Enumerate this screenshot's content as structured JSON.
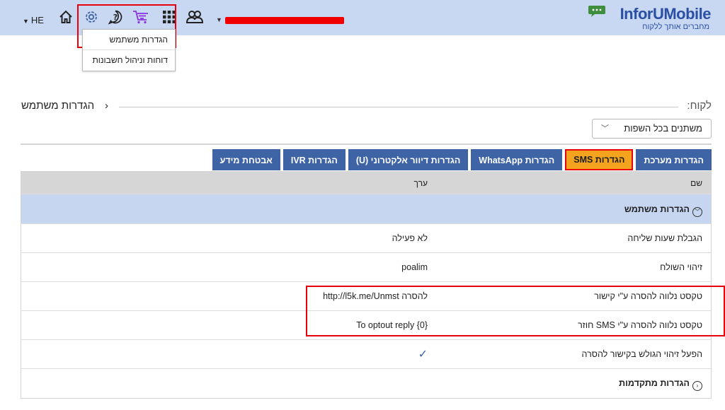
{
  "topbar": {
    "language": "HE",
    "icons": [
      "home-icon",
      "gear-icon",
      "help-icon",
      "cart-icon",
      "apps-grid-icon",
      "users-icon"
    ],
    "colors": {
      "bar_bg": "#c9d8f2",
      "icon_blue": "#3e64a6",
      "cart_purple": "#8b2fe0",
      "highlight_red": "#e8000b"
    }
  },
  "logo": {
    "brand_part1": "InforU",
    "brand_part2": "Mobile",
    "tagline": "מחברים אותך ללקוח"
  },
  "settings_menu": {
    "items": [
      "הגדרות משתמש",
      "דוחות וניהול חשבונות"
    ]
  },
  "heading": {
    "breadcrumb": "הגדרות משתמש",
    "client_label": "לקוח:"
  },
  "filter_select": {
    "value": "משתנים בכל השפות"
  },
  "tabs": [
    {
      "label": "הגדרות מערכת",
      "active": false
    },
    {
      "label": "הגדרות SMS",
      "active": true
    },
    {
      "label": "הגדרות WhatsApp",
      "active": false
    },
    {
      "label": "הגדרות דיוור אלקטרוני (U)",
      "active": false
    },
    {
      "label": "הגדרות IVR",
      "active": false
    },
    {
      "label": "אבטחת מידע",
      "active": false
    }
  ],
  "table": {
    "headers": {
      "name": "שם",
      "value": "ערך"
    },
    "group_title": "הגדרות משתמש",
    "rows": [
      {
        "name": "הגבלת שעות שליחה",
        "value": "לא פעילה"
      },
      {
        "name": "זיהוי השולח",
        "value": "poalim"
      },
      {
        "name": "טקסט נלווה להסרה ע\"י קישור",
        "value": "להסרה http://l5k.me/Unmst"
      },
      {
        "name": "טקסט נלווה להסרה ע\"י SMS חוזר",
        "value": "To optout reply {0}"
      },
      {
        "name": "הפעל זיהוי הגולש בקישור להסרה",
        "value": "✓"
      }
    ],
    "advanced_title": "הגדרות מתקדמות"
  }
}
